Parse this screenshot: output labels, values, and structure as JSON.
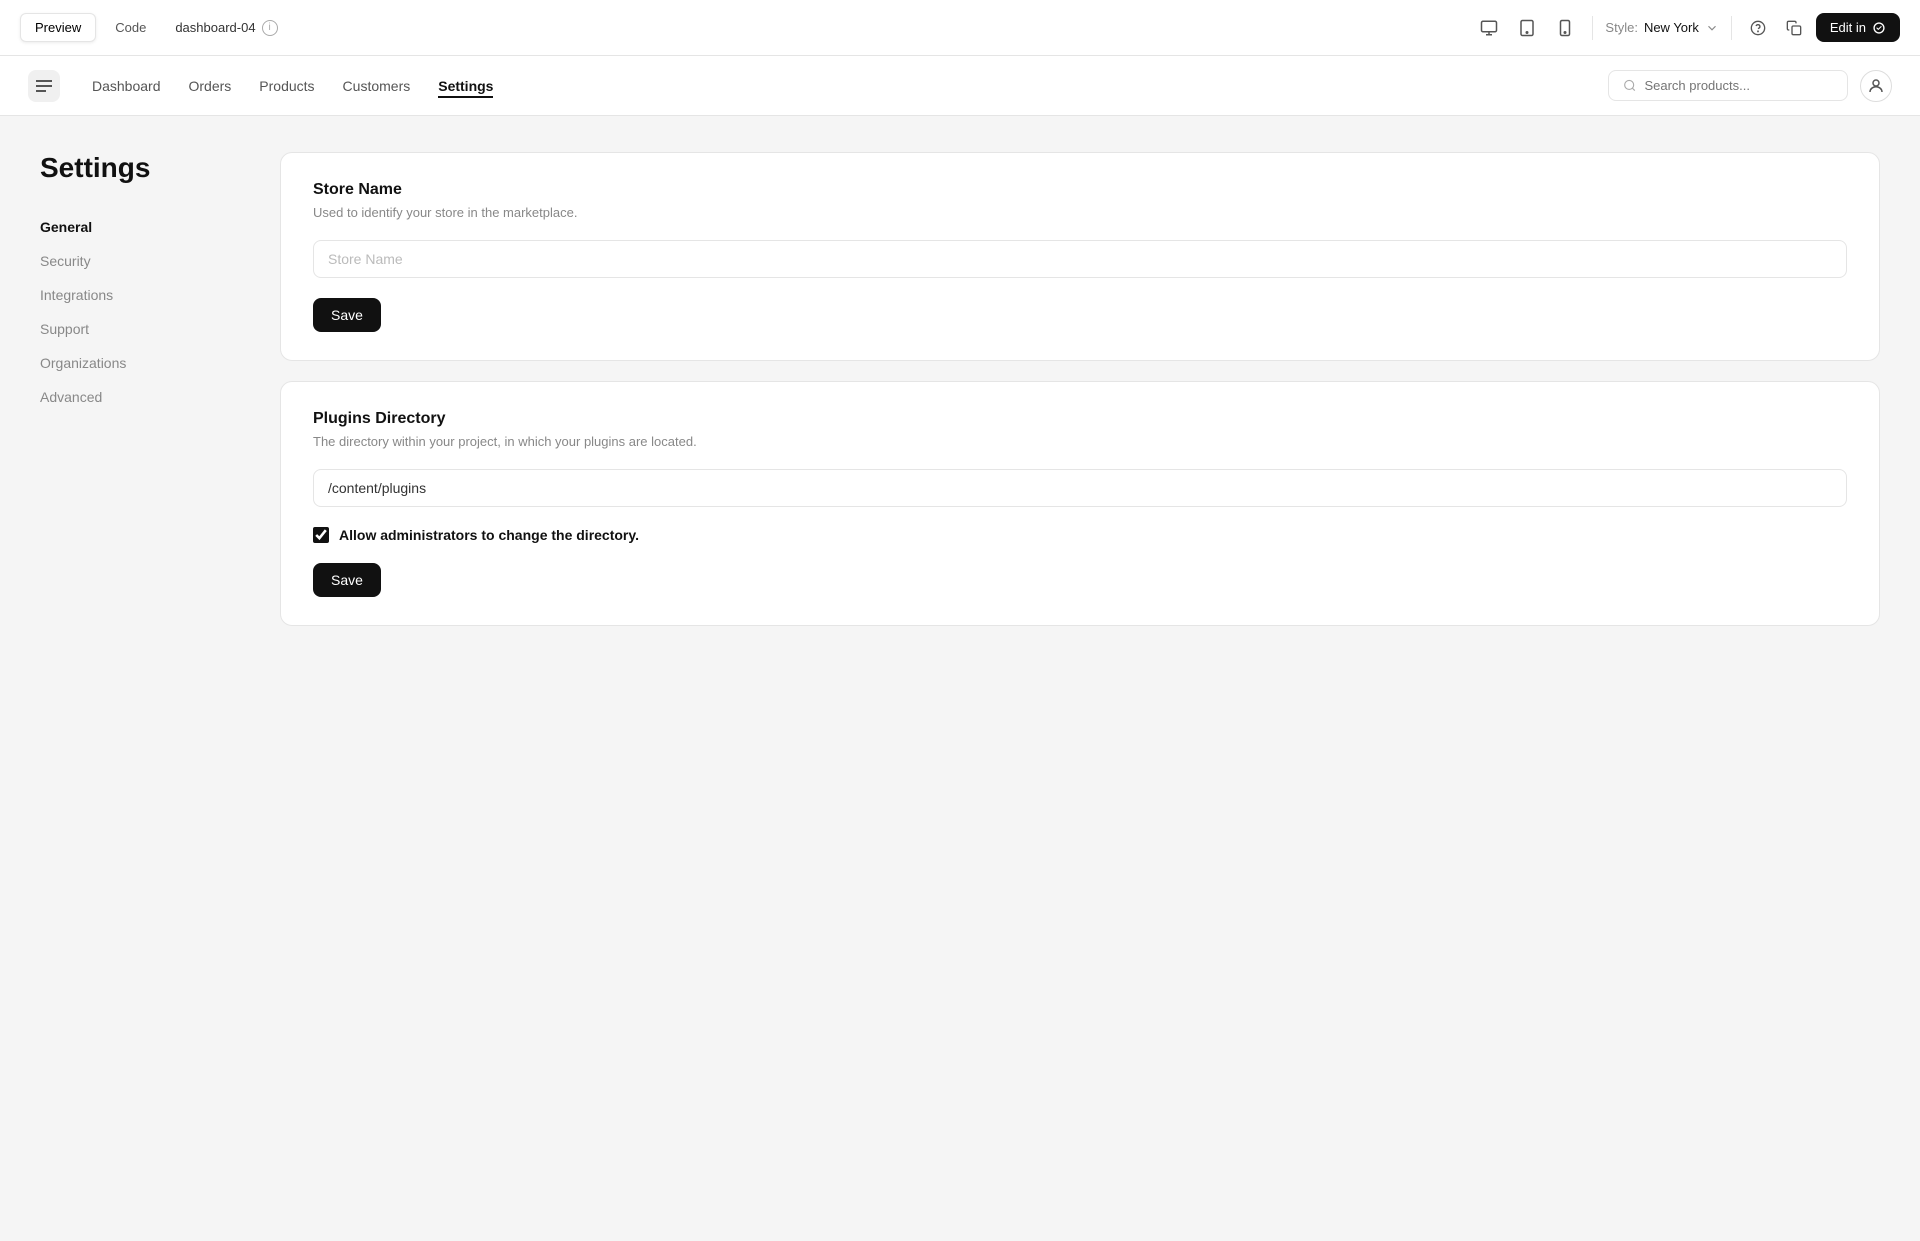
{
  "toolbar": {
    "preview_label": "Preview",
    "code_label": "Code",
    "filename": "dashboard-04",
    "style_label": "Style:",
    "style_value": "New York",
    "edit_label": "Edit in"
  },
  "nav": {
    "links": [
      {
        "label": "Dashboard",
        "active": false
      },
      {
        "label": "Orders",
        "active": false
      },
      {
        "label": "Products",
        "active": false
      },
      {
        "label": "Customers",
        "active": false
      },
      {
        "label": "Settings",
        "active": true
      }
    ],
    "search_placeholder": "Search products...",
    "logo_alt": "shop-icon"
  },
  "settings": {
    "page_title": "Settings",
    "sidebar_items": [
      {
        "label": "General",
        "active": true
      },
      {
        "label": "Security",
        "active": false
      },
      {
        "label": "Integrations",
        "active": false
      },
      {
        "label": "Support",
        "active": false
      },
      {
        "label": "Organizations",
        "active": false
      },
      {
        "label": "Advanced",
        "active": false
      }
    ],
    "store_name_card": {
      "title": "Store Name",
      "description": "Used to identify your store in the marketplace.",
      "placeholder": "Store Name",
      "save_label": "Save"
    },
    "plugins_card": {
      "title": "Plugins Directory",
      "description": "The directory within your project, in which your plugins are located.",
      "field_value": "/content/plugins",
      "checkbox_label": "Allow administrators to change the directory.",
      "checkbox_checked": true,
      "save_label": "Save"
    }
  }
}
